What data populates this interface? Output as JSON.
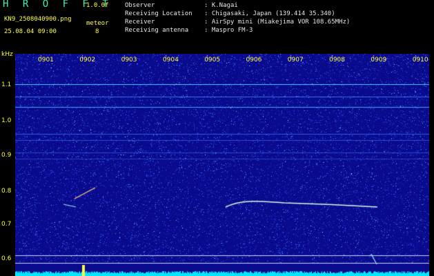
{
  "header": {
    "title": "H R O F F T",
    "version": "1.0.0f",
    "filename": "KN9_2508040900.png",
    "meteor_label": "meteor",
    "meteor_count": "8",
    "datetime": "25.08.04 09:00",
    "observer_label": "Observer",
    "observer_value": ": K.Nagai",
    "location_label": "Receiving Location",
    "location_value": ": Chigasaki, Japan (139.414 35.340)",
    "receiver_label": "Receiver",
    "receiver_value": ": AirSpy mini (Miakejima VOR 108.65MHz)",
    "antenna_label": "Receiving antenna",
    "antenna_value": ": Maspro FM-3"
  },
  "axes": {
    "y_unit": "kHz",
    "y_ticks": [
      "1.1",
      "1.0",
      "0.9",
      "0.8",
      "0.7",
      "0.6"
    ],
    "time_ticks": [
      "0901",
      "0902",
      "0903",
      "0904",
      "0905",
      "0906",
      "0907",
      "0908",
      "0909",
      "0910"
    ]
  },
  "colors": {
    "background": "#000000",
    "spectrogram_base": "#0a0a8c",
    "noise": "#2a5cff",
    "carrier_line": "#3aa8ff",
    "power_trace": "#00e6ff",
    "label_yellow": "#ffff30"
  }
}
